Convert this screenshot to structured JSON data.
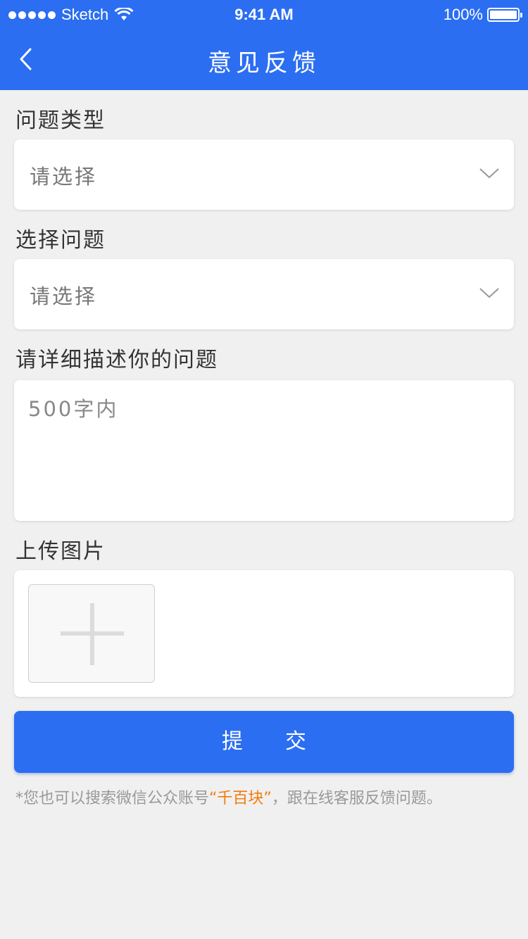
{
  "status_bar": {
    "carrier": "Sketch",
    "time": "9:41 AM",
    "battery": "100%"
  },
  "nav": {
    "title": "意见反馈",
    "back_icon": "chevron-left-icon"
  },
  "sections": {
    "problem_type": {
      "label": "问题类型",
      "placeholder": "请选择"
    },
    "select_problem": {
      "label": "选择问题",
      "placeholder": "请选择"
    },
    "description": {
      "label": "请详细描述你的问题",
      "placeholder": "500字内"
    },
    "upload": {
      "label": "上传图片",
      "icon": "plus-icon"
    }
  },
  "submit_label": "提交",
  "hint": {
    "prefix": "*您也可以搜索微信公众账号",
    "account": "“千百块”",
    "suffix": "，跟在线客服反馈问题。"
  },
  "colors": {
    "primary": "#2b6ef2",
    "background": "#f0f0f0",
    "accent_orange": "#f27b0a"
  }
}
